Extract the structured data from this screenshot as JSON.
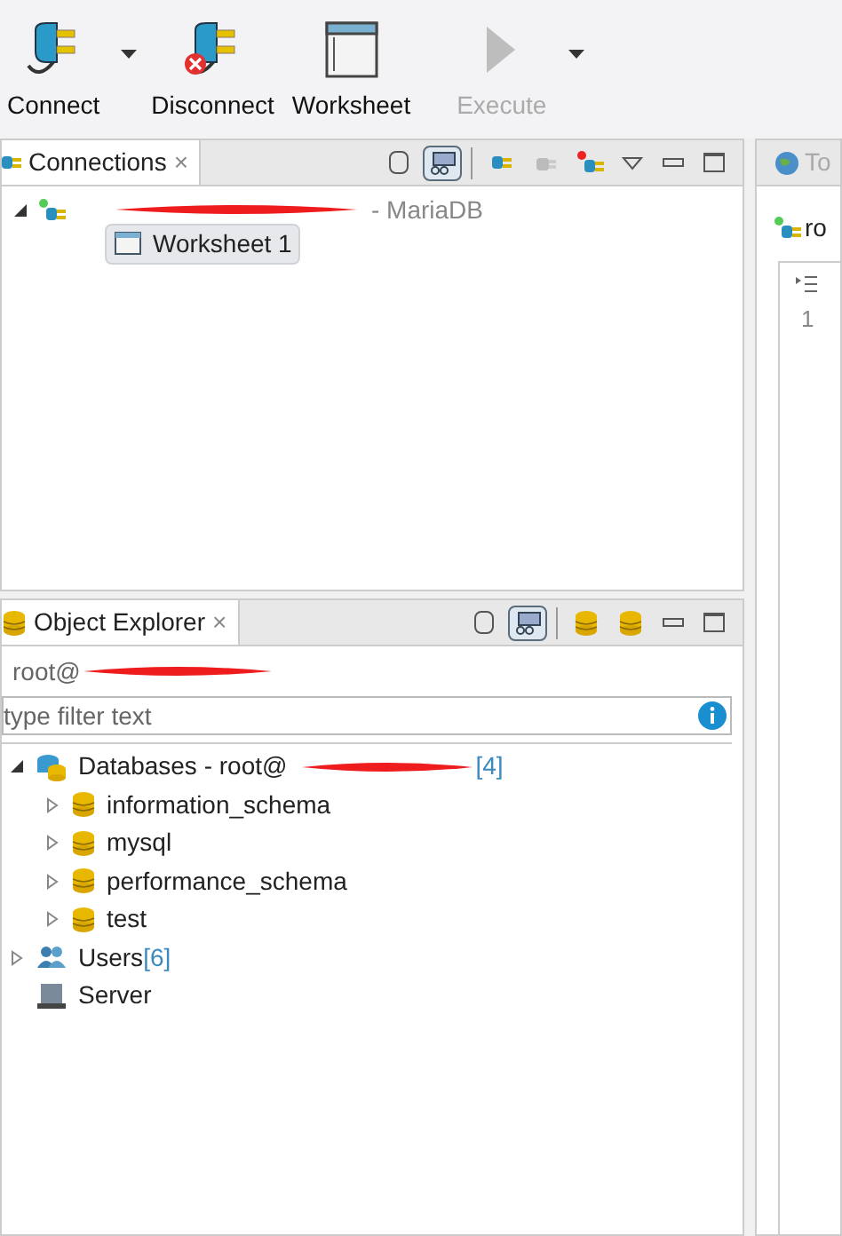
{
  "toolbar": {
    "buttons": [
      {
        "label": "Connect",
        "kind": "connect",
        "disabled": false,
        "dropdown": true
      },
      {
        "label": "Disconnect",
        "kind": "disconnect",
        "disabled": false,
        "dropdown": false
      },
      {
        "label": "Worksheet",
        "kind": "worksheet",
        "disabled": false,
        "dropdown": false
      },
      {
        "label": "Execute",
        "kind": "execute",
        "disabled": true,
        "dropdown": true
      }
    ]
  },
  "connections": {
    "title": "Connections",
    "close": "×",
    "tree": [
      {
        "label": "- MariaDB",
        "expanded": true,
        "children": [
          {
            "label": "Worksheet 1",
            "selected": true
          }
        ]
      }
    ]
  },
  "object_explorer": {
    "title": "Object Explorer",
    "close": "×",
    "connection": "root@",
    "filter": {
      "placeholder": "type filter text"
    },
    "tree": [
      {
        "label": "Databases - root@",
        "count": "[4]",
        "kind": "databases",
        "expanded": true,
        "children": [
          {
            "label": "information_schema",
            "kind": "database",
            "expanded": false
          },
          {
            "label": "mysql",
            "kind": "database",
            "expanded": false
          },
          {
            "label": "performance_schema",
            "kind": "database",
            "expanded": false
          },
          {
            "label": "test",
            "kind": "database",
            "expanded": false
          }
        ]
      },
      {
        "label": "Users",
        "count": "[6]",
        "kind": "users",
        "expanded": false
      },
      {
        "label": "Server",
        "kind": "server"
      }
    ]
  },
  "editor": {
    "tab": "To",
    "connection": "ro",
    "line_numbers": [
      "1"
    ]
  }
}
